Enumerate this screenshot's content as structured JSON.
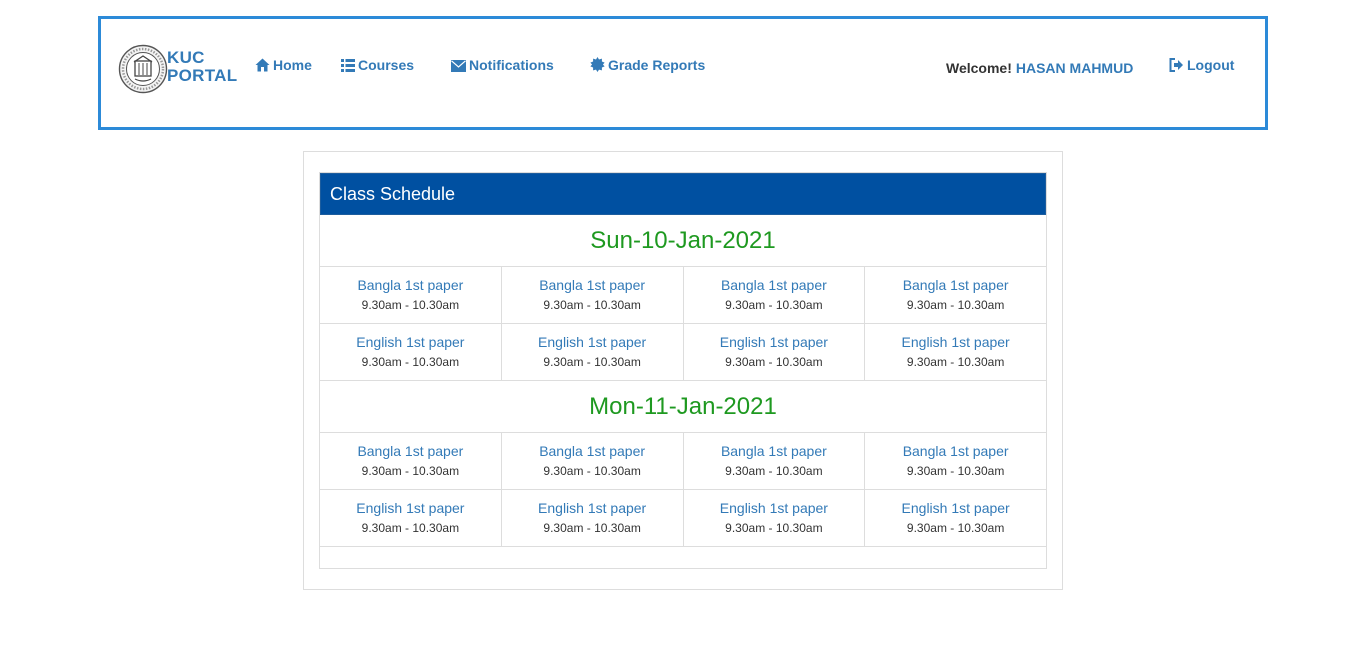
{
  "header": {
    "brand_line1": "KUC",
    "brand_line2": "PORTAL",
    "nav": [
      {
        "label": "Home",
        "icon": "home-icon"
      },
      {
        "label": "Courses",
        "icon": "list-icon"
      },
      {
        "label": "Notifications",
        "icon": "envelope-icon"
      },
      {
        "label": "Grade Reports",
        "icon": "certificate-icon"
      }
    ],
    "welcome_label": "Welcome!",
    "user_name": "HASAN MAHMUD",
    "logout_label": "Logout",
    "logout_icon": "logout-icon"
  },
  "schedule": {
    "title": "Class Schedule",
    "days": [
      {
        "date": "Sun-10-Jan-2021",
        "rows": [
          [
            {
              "course": "Bangla 1st paper",
              "time": "9.30am - 10.30am"
            },
            {
              "course": "Bangla 1st paper",
              "time": "9.30am - 10.30am"
            },
            {
              "course": "Bangla 1st paper",
              "time": "9.30am - 10.30am"
            },
            {
              "course": "Bangla 1st paper",
              "time": "9.30am - 10.30am"
            }
          ],
          [
            {
              "course": "English 1st paper",
              "time": "9.30am - 10.30am"
            },
            {
              "course": "English 1st paper",
              "time": "9.30am - 10.30am"
            },
            {
              "course": "English 1st paper",
              "time": "9.30am - 10.30am"
            },
            {
              "course": "English 1st paper",
              "time": "9.30am - 10.30am"
            }
          ]
        ]
      },
      {
        "date": "Mon-11-Jan-2021",
        "rows": [
          [
            {
              "course": "Bangla 1st paper",
              "time": "9.30am - 10.30am"
            },
            {
              "course": "Bangla 1st paper",
              "time": "9.30am - 10.30am"
            },
            {
              "course": "Bangla 1st paper",
              "time": "9.30am - 10.30am"
            },
            {
              "course": "Bangla 1st paper",
              "time": "9.30am - 10.30am"
            }
          ],
          [
            {
              "course": "English 1st paper",
              "time": "9.30am - 10.30am"
            },
            {
              "course": "English 1st paper",
              "time": "9.30am - 10.30am"
            },
            {
              "course": "English 1st paper",
              "time": "9.30am - 10.30am"
            },
            {
              "course": "English 1st paper",
              "time": "9.30am - 10.30am"
            }
          ]
        ]
      }
    ]
  },
  "colors": {
    "accent": "#337ab7",
    "header_border": "#2c8ad8",
    "panel_heading": "#0050a1",
    "date_green": "#1e9920"
  }
}
